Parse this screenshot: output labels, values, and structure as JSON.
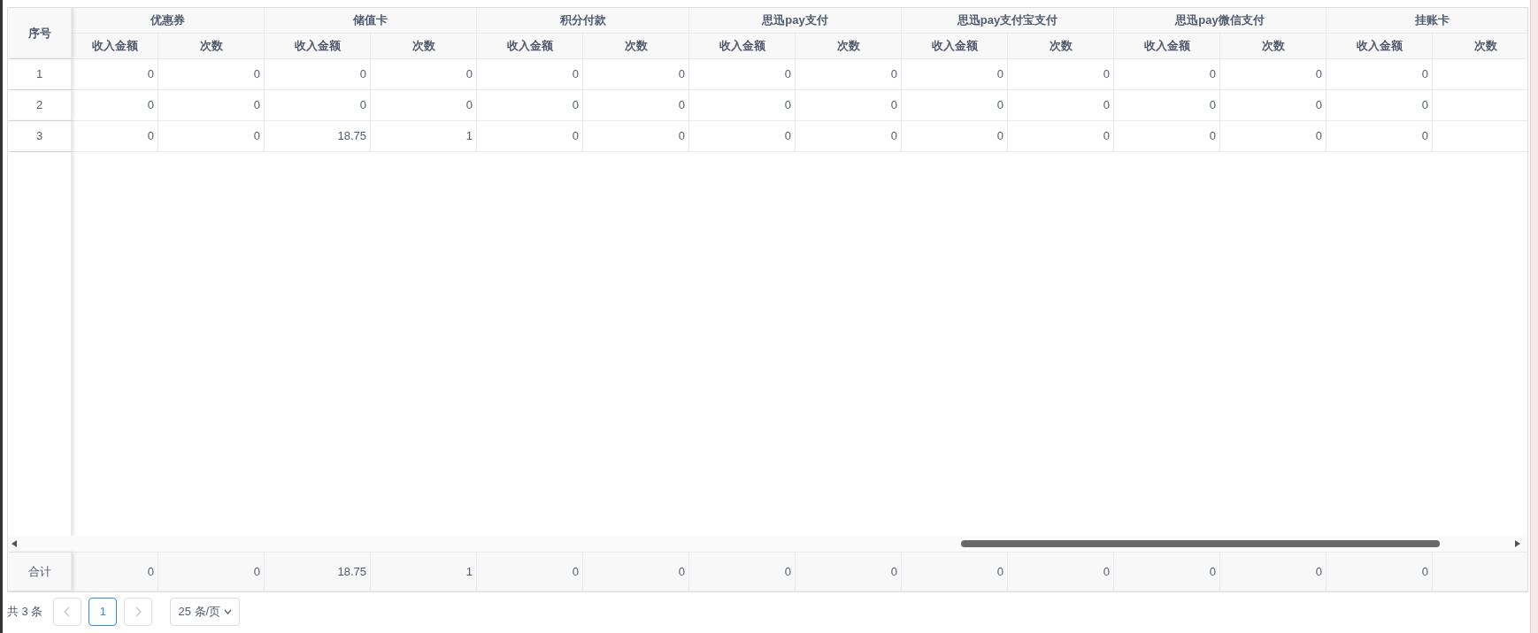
{
  "table": {
    "index_header": "序号",
    "groups": [
      {
        "title": "优惠券",
        "columns": [
          "收入金额",
          "次数"
        ]
      },
      {
        "title": "储值卡",
        "columns": [
          "收入金额",
          "次数"
        ]
      },
      {
        "title": "积分付款",
        "columns": [
          "收入金额",
          "次数"
        ]
      },
      {
        "title": "思迅pay支付",
        "columns": [
          "收入金额",
          "次数"
        ]
      },
      {
        "title": "思迅pay支付宝支付",
        "columns": [
          "收入金额",
          "次数"
        ]
      },
      {
        "title": "思迅pay微信支付",
        "columns": [
          "收入金额",
          "次数"
        ]
      },
      {
        "title": "挂账卡",
        "columns": [
          "收入金额",
          "次数"
        ]
      }
    ],
    "rows": [
      {
        "index": "1",
        "cells": [
          "0",
          "0",
          "0",
          "0",
          "0",
          "0",
          "0",
          "0",
          "0",
          "0",
          "0",
          "0",
          "0"
        ]
      },
      {
        "index": "2",
        "cells": [
          "0",
          "0",
          "0",
          "0",
          "0",
          "0",
          "0",
          "0",
          "0",
          "0",
          "0",
          "0",
          "0"
        ]
      },
      {
        "index": "3",
        "cells": [
          "0",
          "0",
          "18.75",
          "1",
          "0",
          "0",
          "0",
          "0",
          "0",
          "0",
          "0",
          "0",
          "0"
        ]
      }
    ],
    "footer": {
      "label": "合计",
      "cells": [
        "0",
        "0",
        "18.75",
        "1",
        "0",
        "0",
        "0",
        "0",
        "0",
        "0",
        "0",
        "0",
        "0"
      ]
    }
  },
  "pagination": {
    "total": "共 3 条",
    "prev_disabled": true,
    "next_disabled": true,
    "pages": [
      {
        "label": "1",
        "selected": true
      }
    ],
    "page_size": "25 条/页"
  }
}
